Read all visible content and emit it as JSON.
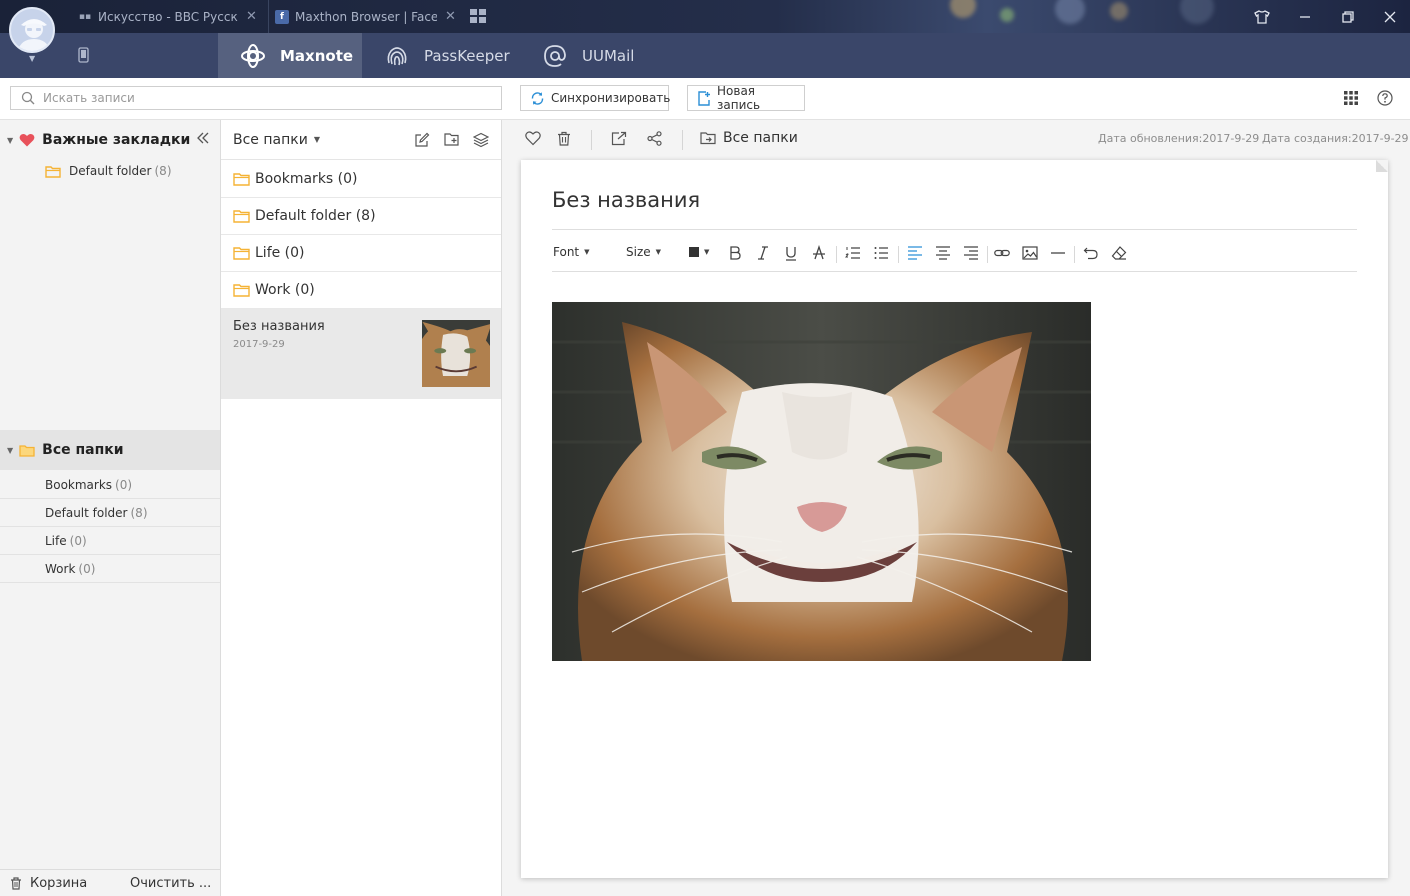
{
  "browser": {
    "tabs": [
      {
        "label": "Искусство - BBC Русск...",
        "favicon": "bbc-favicon"
      },
      {
        "label": "Maxthon Browser | Faceb...",
        "favicon": "facebook-favicon"
      }
    ]
  },
  "appbar": {
    "tabs": [
      {
        "label": "Maxnote",
        "icon": "maxnote-icon",
        "active": true
      },
      {
        "label": "PassKeeper",
        "icon": "fingerprint-icon",
        "active": false
      },
      {
        "label": "UUMail",
        "icon": "mail-at-icon",
        "active": false
      }
    ]
  },
  "toolbar": {
    "search_placeholder": "Искать записи",
    "sync_label": "Синхронизировать",
    "new_note_label": "Новая запись"
  },
  "sidebar": {
    "favorites_title": "Важные закладки",
    "favorites": [
      {
        "name": "Default folder",
        "count": "(8)"
      }
    ],
    "all_folders_title": "Все папки",
    "folders": [
      {
        "name": "Bookmarks",
        "count": "(0)"
      },
      {
        "name": "Default folder",
        "count": "(8)"
      },
      {
        "name": "Life",
        "count": "(0)"
      },
      {
        "name": "Work",
        "count": "(0)"
      }
    ],
    "trash_label": "Корзина",
    "empty_trash_label": "Очистить ..."
  },
  "middle": {
    "header": "Все папки",
    "folders": [
      "Bookmarks (0)",
      "Default folder (8)",
      "Life (0)",
      "Work (0)"
    ],
    "note": {
      "title": "Без названия",
      "date": "2017-9-29"
    }
  },
  "editor": {
    "folder_label": "Все папки",
    "date_updated": "Дата обновления:2017-9-29",
    "date_created": "Дата создания:2017-9-29",
    "title": "Без названия",
    "format": {
      "font_label": "Font",
      "size_label": "Size"
    }
  },
  "colors": {
    "appbar": "#3a4669",
    "active_tab": "#56617f",
    "folder": "#f5b335",
    "heart": "#e8515a",
    "accent": "#2b8fd6"
  }
}
